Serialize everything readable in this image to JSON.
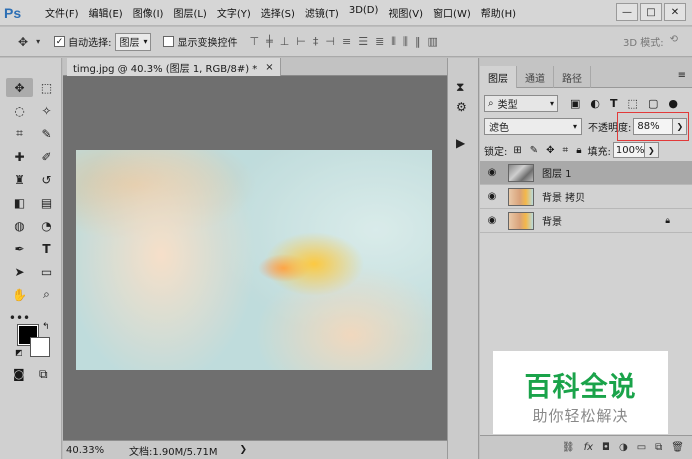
{
  "app": {
    "logo": "Ps",
    "menu": [
      "文件(F)",
      "编辑(E)",
      "图像(I)",
      "图层(L)",
      "文字(Y)",
      "选择(S)",
      "滤镜(T)",
      "3D(D)",
      "视图(V)",
      "窗口(W)",
      "帮助(H)"
    ],
    "window_controls": [
      "—",
      "□",
      "✕"
    ]
  },
  "options_bar": {
    "auto_select_label": "自动选择:",
    "auto_select_value": "图层",
    "show_transform_label": "显示变换控件",
    "mode_3d_label": "3D 模式:"
  },
  "document": {
    "tab_title": "timg.jpg @ 40.3% (图层 1, RGB/8#) *",
    "tab_close": "×",
    "zoom": "40.33%",
    "doc_info": "文档:1.90M/5.71M"
  },
  "layers_panel": {
    "tabs": [
      "图层",
      "通道",
      "路径"
    ],
    "filter_kind": "类型",
    "blend_mode": "滤色",
    "opacity_label": "不透明度:",
    "opacity_value": "88%",
    "lock_label": "锁定:",
    "fill_label": "填充:",
    "fill_value": "100%",
    "layers": [
      {
        "name": "图层 1",
        "selected": true,
        "locked": false
      },
      {
        "name": "背景 拷贝",
        "selected": false,
        "locked": false
      },
      {
        "name": "背景",
        "selected": false,
        "locked": true
      }
    ]
  },
  "watermark": {
    "main": "百科全说",
    "sub": "助你轻松解决"
  },
  "colors": {
    "accent_highlight": "#e23a3a",
    "watermark_green": "#1aa34a"
  }
}
